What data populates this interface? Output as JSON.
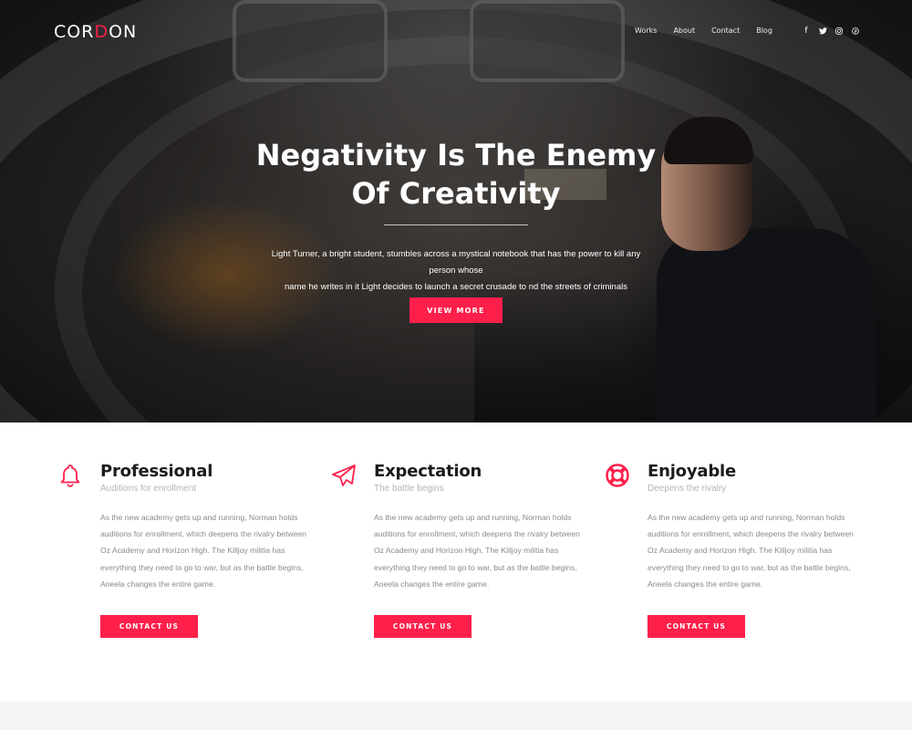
{
  "brand": {
    "logo_left": "COR",
    "logo_d": "D",
    "logo_right": "ON",
    "accent": "#ff1f4b"
  },
  "nav": {
    "items": [
      "Works",
      "About",
      "Contact",
      "Blog"
    ]
  },
  "social": {
    "icons": [
      "facebook-icon",
      "twitter-icon",
      "instagram-icon",
      "pinterest-icon"
    ]
  },
  "hero": {
    "title_line1": "Negativity Is The Enemy",
    "title_line2": "Of Creativity",
    "description_line1": "Light Turner, a bright student, stumbles across a mystical notebook that has the power to kill any person whose",
    "description_line2": "name he writes in it Light decides to launch a secret crusade to nd the streets of criminals",
    "button": "VIEW MORE"
  },
  "features": [
    {
      "icon": "bell-icon",
      "title": "Professional",
      "subtitle": "Auditions for enrollment",
      "text": "As the new academy gets up and running, Norman holds auditions for enrollment, which deepens the rivalry between Oz Academy and Horizon High. The Killjoy militia has everything they need to go to war, but as the battle begins, Aneela changes the entire game.",
      "button": "CONTACT US"
    },
    {
      "icon": "paper-plane-icon",
      "title": "Expectation",
      "subtitle": "The battle begins",
      "text": "As the new academy gets up and running, Norman holds auditions for enrollment, which deepens the rivalry between Oz Academy and Horizon High. The Killjoy militia has everything they need to go to war, but as the battle begins, Aneela changes the entire game.",
      "button": "CONTACT US"
    },
    {
      "icon": "life-ring-icon",
      "title": "Enjoyable",
      "subtitle": "Deepens the rivalry",
      "text": "As the new academy gets up and running, Norman holds auditions for enrollment, which deepens the rivalry between Oz Academy and Horizon High. The Killjoy militia has everything they need to go to war, but as the battle begins, Aneela changes the entire game.",
      "button": "CONTACT US"
    }
  ]
}
